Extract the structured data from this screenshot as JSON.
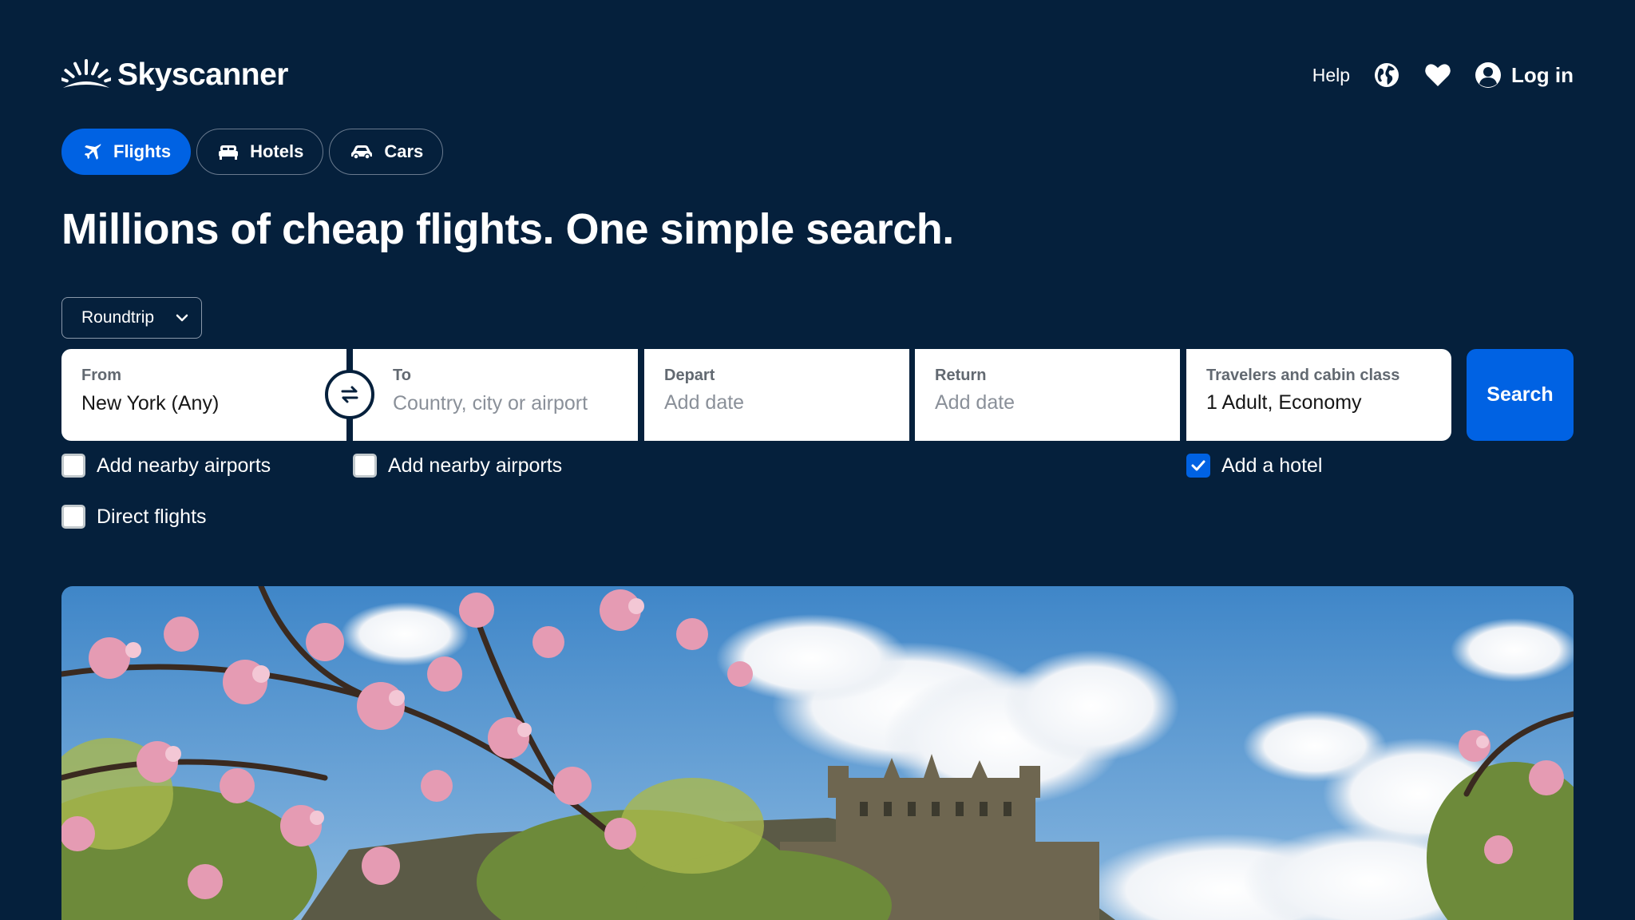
{
  "brand": {
    "name": "Skyscanner"
  },
  "header": {
    "help_label": "Help",
    "globe_icon": "globe-icon",
    "heart_icon": "heart-icon",
    "login_label": "Log in"
  },
  "tabs": [
    {
      "label": "Flights",
      "icon": "plane-icon",
      "active": true
    },
    {
      "label": "Hotels",
      "icon": "bed-icon",
      "active": false
    },
    {
      "label": "Cars",
      "icon": "car-icon",
      "active": false
    }
  ],
  "headline": "Millions of cheap flights. One simple search.",
  "trip_type": {
    "selected": "Roundtrip"
  },
  "search": {
    "from": {
      "label": "From",
      "value": "New York (Any)"
    },
    "to": {
      "label": "To",
      "placeholder": "Country, city or airport"
    },
    "depart": {
      "label": "Depart",
      "placeholder": "Add date"
    },
    "return": {
      "label": "Return",
      "placeholder": "Add date"
    },
    "travelers": {
      "label": "Travelers and cabin class",
      "value": "1 Adult, Economy"
    },
    "button_label": "Search"
  },
  "options": {
    "from_nearby": {
      "label": "Add nearby airports",
      "checked": false
    },
    "to_nearby": {
      "label": "Add nearby airports",
      "checked": false
    },
    "add_hotel": {
      "label": "Add a hotel",
      "checked": true
    },
    "direct_flights": {
      "label": "Direct flights",
      "checked": false
    }
  },
  "colors": {
    "background": "#05203c",
    "accent": "#0062e3",
    "white": "#ffffff"
  }
}
